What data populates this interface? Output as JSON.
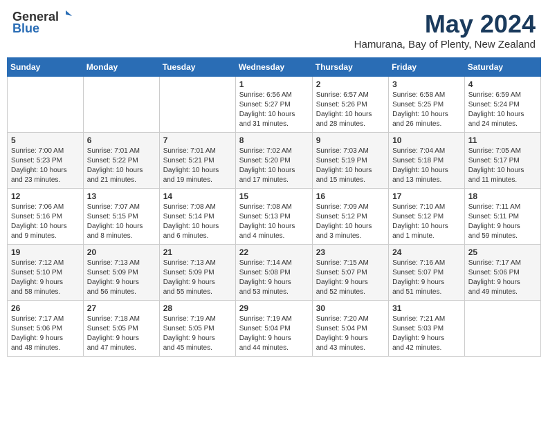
{
  "header": {
    "logo_general": "General",
    "logo_blue": "Blue",
    "month_title": "May 2024",
    "location": "Hamurana, Bay of Plenty, New Zealand"
  },
  "days_of_week": [
    "Sunday",
    "Monday",
    "Tuesday",
    "Wednesday",
    "Thursday",
    "Friday",
    "Saturday"
  ],
  "weeks": [
    [
      {
        "day": "",
        "info": ""
      },
      {
        "day": "",
        "info": ""
      },
      {
        "day": "",
        "info": ""
      },
      {
        "day": "1",
        "info": "Sunrise: 6:56 AM\nSunset: 5:27 PM\nDaylight: 10 hours\nand 31 minutes."
      },
      {
        "day": "2",
        "info": "Sunrise: 6:57 AM\nSunset: 5:26 PM\nDaylight: 10 hours\nand 28 minutes."
      },
      {
        "day": "3",
        "info": "Sunrise: 6:58 AM\nSunset: 5:25 PM\nDaylight: 10 hours\nand 26 minutes."
      },
      {
        "day": "4",
        "info": "Sunrise: 6:59 AM\nSunset: 5:24 PM\nDaylight: 10 hours\nand 24 minutes."
      }
    ],
    [
      {
        "day": "5",
        "info": "Sunrise: 7:00 AM\nSunset: 5:23 PM\nDaylight: 10 hours\nand 23 minutes."
      },
      {
        "day": "6",
        "info": "Sunrise: 7:01 AM\nSunset: 5:22 PM\nDaylight: 10 hours\nand 21 minutes."
      },
      {
        "day": "7",
        "info": "Sunrise: 7:01 AM\nSunset: 5:21 PM\nDaylight: 10 hours\nand 19 minutes."
      },
      {
        "day": "8",
        "info": "Sunrise: 7:02 AM\nSunset: 5:20 PM\nDaylight: 10 hours\nand 17 minutes."
      },
      {
        "day": "9",
        "info": "Sunrise: 7:03 AM\nSunset: 5:19 PM\nDaylight: 10 hours\nand 15 minutes."
      },
      {
        "day": "10",
        "info": "Sunrise: 7:04 AM\nSunset: 5:18 PM\nDaylight: 10 hours\nand 13 minutes."
      },
      {
        "day": "11",
        "info": "Sunrise: 7:05 AM\nSunset: 5:17 PM\nDaylight: 10 hours\nand 11 minutes."
      }
    ],
    [
      {
        "day": "12",
        "info": "Sunrise: 7:06 AM\nSunset: 5:16 PM\nDaylight: 10 hours\nand 9 minutes."
      },
      {
        "day": "13",
        "info": "Sunrise: 7:07 AM\nSunset: 5:15 PM\nDaylight: 10 hours\nand 8 minutes."
      },
      {
        "day": "14",
        "info": "Sunrise: 7:08 AM\nSunset: 5:14 PM\nDaylight: 10 hours\nand 6 minutes."
      },
      {
        "day": "15",
        "info": "Sunrise: 7:08 AM\nSunset: 5:13 PM\nDaylight: 10 hours\nand 4 minutes."
      },
      {
        "day": "16",
        "info": "Sunrise: 7:09 AM\nSunset: 5:12 PM\nDaylight: 10 hours\nand 3 minutes."
      },
      {
        "day": "17",
        "info": "Sunrise: 7:10 AM\nSunset: 5:12 PM\nDaylight: 10 hours\nand 1 minute."
      },
      {
        "day": "18",
        "info": "Sunrise: 7:11 AM\nSunset: 5:11 PM\nDaylight: 9 hours\nand 59 minutes."
      }
    ],
    [
      {
        "day": "19",
        "info": "Sunrise: 7:12 AM\nSunset: 5:10 PM\nDaylight: 9 hours\nand 58 minutes."
      },
      {
        "day": "20",
        "info": "Sunrise: 7:13 AM\nSunset: 5:09 PM\nDaylight: 9 hours\nand 56 minutes."
      },
      {
        "day": "21",
        "info": "Sunrise: 7:13 AM\nSunset: 5:09 PM\nDaylight: 9 hours\nand 55 minutes."
      },
      {
        "day": "22",
        "info": "Sunrise: 7:14 AM\nSunset: 5:08 PM\nDaylight: 9 hours\nand 53 minutes."
      },
      {
        "day": "23",
        "info": "Sunrise: 7:15 AM\nSunset: 5:07 PM\nDaylight: 9 hours\nand 52 minutes."
      },
      {
        "day": "24",
        "info": "Sunrise: 7:16 AM\nSunset: 5:07 PM\nDaylight: 9 hours\nand 51 minutes."
      },
      {
        "day": "25",
        "info": "Sunrise: 7:17 AM\nSunset: 5:06 PM\nDaylight: 9 hours\nand 49 minutes."
      }
    ],
    [
      {
        "day": "26",
        "info": "Sunrise: 7:17 AM\nSunset: 5:06 PM\nDaylight: 9 hours\nand 48 minutes."
      },
      {
        "day": "27",
        "info": "Sunrise: 7:18 AM\nSunset: 5:05 PM\nDaylight: 9 hours\nand 47 minutes."
      },
      {
        "day": "28",
        "info": "Sunrise: 7:19 AM\nSunset: 5:05 PM\nDaylight: 9 hours\nand 45 minutes."
      },
      {
        "day": "29",
        "info": "Sunrise: 7:19 AM\nSunset: 5:04 PM\nDaylight: 9 hours\nand 44 minutes."
      },
      {
        "day": "30",
        "info": "Sunrise: 7:20 AM\nSunset: 5:04 PM\nDaylight: 9 hours\nand 43 minutes."
      },
      {
        "day": "31",
        "info": "Sunrise: 7:21 AM\nSunset: 5:03 PM\nDaylight: 9 hours\nand 42 minutes."
      },
      {
        "day": "",
        "info": ""
      }
    ]
  ]
}
